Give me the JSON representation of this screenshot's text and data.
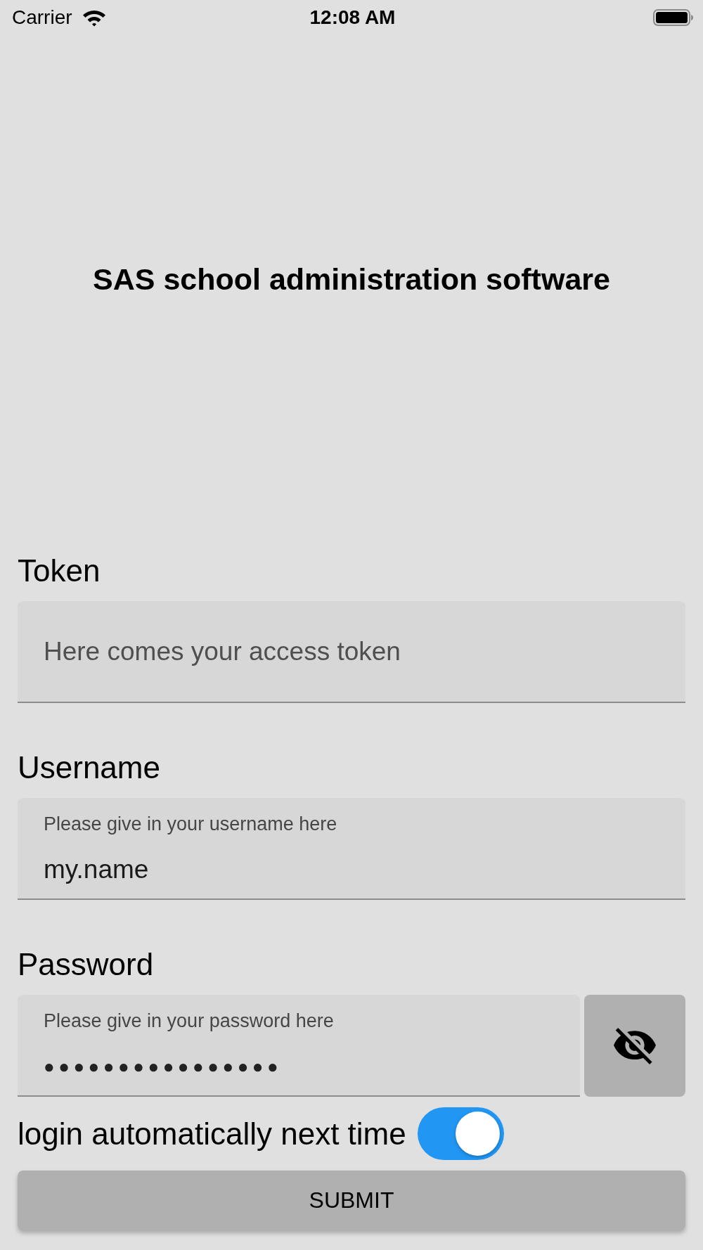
{
  "status_bar": {
    "carrier": "Carrier",
    "time": "12:08 AM"
  },
  "title": "SAS school administration software",
  "token": {
    "label": "Token",
    "placeholder": "Here comes your access token"
  },
  "username": {
    "label": "Username",
    "floating_label": "Please give in your username here",
    "value": "my.name"
  },
  "password": {
    "label": "Password",
    "floating_label": "Please give in your password here",
    "value": "●●●●●●●●●●●●●●●●",
    "visible": false
  },
  "auto_login": {
    "label": "login automatically next time",
    "on": true
  },
  "submit": {
    "label": "SUBMIT"
  }
}
